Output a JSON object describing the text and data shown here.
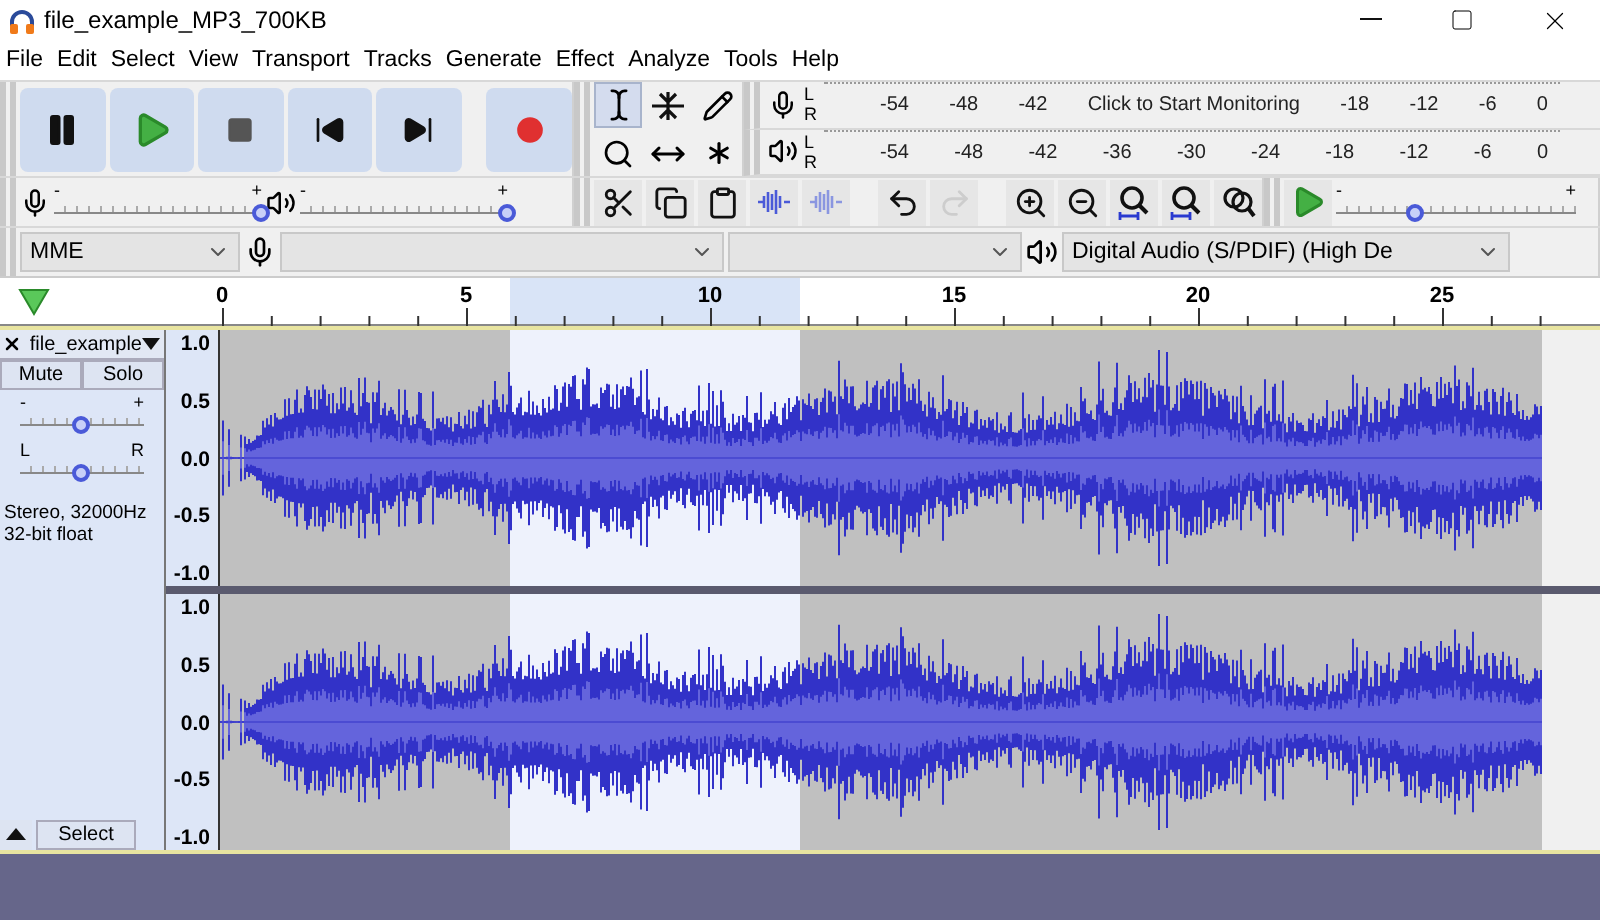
{
  "window": {
    "title": "file_example_MP3_700KB"
  },
  "menu": [
    "File",
    "Edit",
    "Select",
    "View",
    "Transport",
    "Tracks",
    "Generate",
    "Effect",
    "Analyze",
    "Tools",
    "Help"
  ],
  "transport": [
    {
      "kind": "pause"
    },
    {
      "kind": "play"
    },
    {
      "kind": "stop"
    },
    {
      "kind": "skip-start"
    },
    {
      "kind": "skip-end"
    },
    {
      "kind": "record"
    }
  ],
  "tools": [
    {
      "kind": "select",
      "selected": true
    },
    {
      "kind": "envelope",
      "selected": false
    },
    {
      "kind": "draw",
      "selected": false
    },
    {
      "kind": "zoom",
      "selected": false
    },
    {
      "kind": "time-shift",
      "selected": false
    },
    {
      "kind": "multi",
      "selected": false
    }
  ],
  "meters": [
    {
      "kind": "recording",
      "channels": [
        "L",
        "R"
      ],
      "labels": [
        "-54",
        "-48",
        "-42",
        "Click to Start Monitoring",
        "-18",
        "-12",
        "-6",
        "0"
      ]
    },
    {
      "kind": "playback",
      "channels": [
        "L",
        "R"
      ],
      "labels": [
        "-54",
        "-48",
        "-42",
        "-36",
        "-30",
        "-24",
        "-18",
        "-12",
        "-6",
        "0"
      ]
    }
  ],
  "mixer": [
    {
      "kind": "recording",
      "min_label": "-",
      "max_label": "+",
      "level": 1
    },
    {
      "kind": "playback",
      "min_label": "-",
      "max_label": "+",
      "level": 1
    }
  ],
  "edit_tools": [
    {
      "kind": "cut",
      "disabled": false
    },
    {
      "kind": "copy",
      "disabled": false
    },
    {
      "kind": "paste",
      "disabled": false
    },
    {
      "kind": "trim",
      "disabled": false
    },
    {
      "kind": "silence",
      "disabled": false
    },
    {
      "kind": "undo",
      "disabled": false
    },
    {
      "kind": "redo",
      "disabled": true
    },
    {
      "kind": "zoom-in",
      "disabled": false
    },
    {
      "kind": "zoom-out",
      "disabled": false
    },
    {
      "kind": "fit-selection",
      "disabled": false
    },
    {
      "kind": "fit-project",
      "disabled": false
    },
    {
      "kind": "zoom-toggle",
      "disabled": false
    }
  ],
  "play_at_speed": {
    "min_label": "-",
    "max_label": "+",
    "level": 0.33
  },
  "devices": [
    {
      "kind": "host",
      "value": "MME"
    },
    {
      "kind": "recording"
    },
    {
      "kind": "channels"
    },
    {
      "kind": "playback",
      "value": "Digital Audio (S/PDIF) (High De"
    }
  ],
  "ruler": {
    "labels": [
      "0",
      "5",
      "10",
      "15",
      "20",
      "25"
    ]
  },
  "track": {
    "name": "file_example",
    "buttons": [
      "Mute",
      "Solo"
    ],
    "gain": {
      "min_label": "-",
      "max_label": "+",
      "level": 0.5
    },
    "pan": {
      "min_label": "L",
      "max_label": "R",
      "level": 0.5
    },
    "info": [
      "Stereo, 32000Hz",
      "32-bit float"
    ],
    "select_button": "Select",
    "channels": [
      {
        "scale": [
          "1.0",
          "0.5",
          "0.0",
          "-0.5",
          "-1.0"
        ]
      },
      {
        "scale": [
          "1.0",
          "0.5",
          "0.0",
          "-0.5",
          "-1.0"
        ]
      }
    ]
  }
}
